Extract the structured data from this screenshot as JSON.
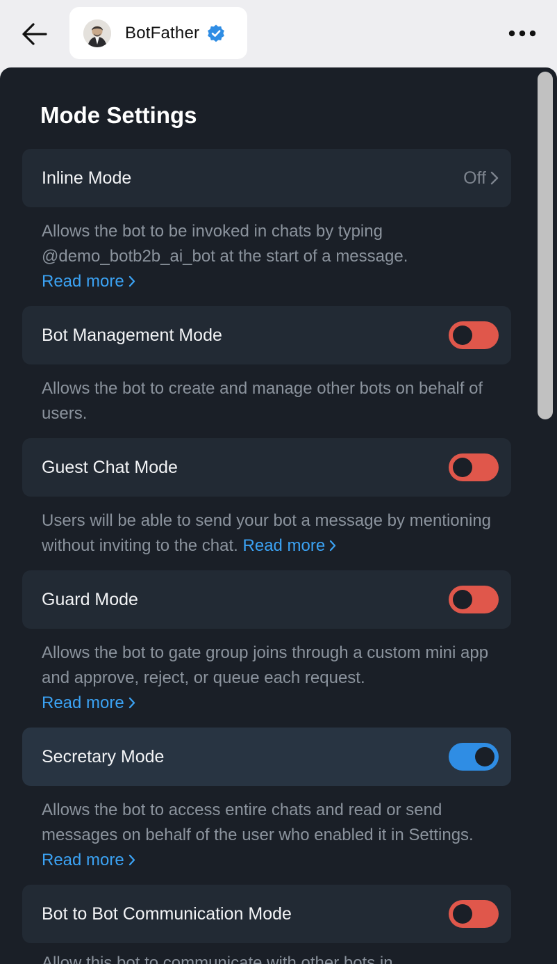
{
  "header": {
    "chat_name": "BotFather",
    "icons": {
      "back": "arrow-left-icon",
      "verified": "verified-badge-icon",
      "more": "more-horizontal-icon"
    }
  },
  "panel": {
    "title": "Mode Settings",
    "read_more": "Read more",
    "rows": [
      {
        "label": "Inline Mode",
        "value": "Off",
        "description": "Allows the bot to be invoked in chats by typing @demo_botb2b_ai_bot at the start of a message."
      },
      {
        "label": "Bot Management Mode",
        "toggle": false,
        "description": "Allows the bot to create and manage other bots on behalf of users."
      },
      {
        "label": "Guest Chat Mode",
        "toggle": false,
        "description": "Users will be able to send your bot a message by mentioning without inviting to the chat."
      },
      {
        "label": "Guard Mode",
        "toggle": false,
        "description": "Allows the bot to gate group joins through a custom mini app and approve, reject, or queue each request."
      },
      {
        "label": "Secretary Mode",
        "toggle": true,
        "description": "Allows the bot to access entire chats and read or send messages on behalf of the user who enabled it in Settings."
      },
      {
        "label": "Bot to Bot Communication Mode",
        "toggle": false,
        "description": "Allow this bot to communicate with other bots in"
      }
    ]
  },
  "colors": {
    "panel_bg": "#1a1f27",
    "row_bg": "#222a34",
    "toggle_off": "#e0574b",
    "toggle_on": "#2f8de4",
    "link": "#3ba2f3",
    "verified": "#2f8de4"
  }
}
